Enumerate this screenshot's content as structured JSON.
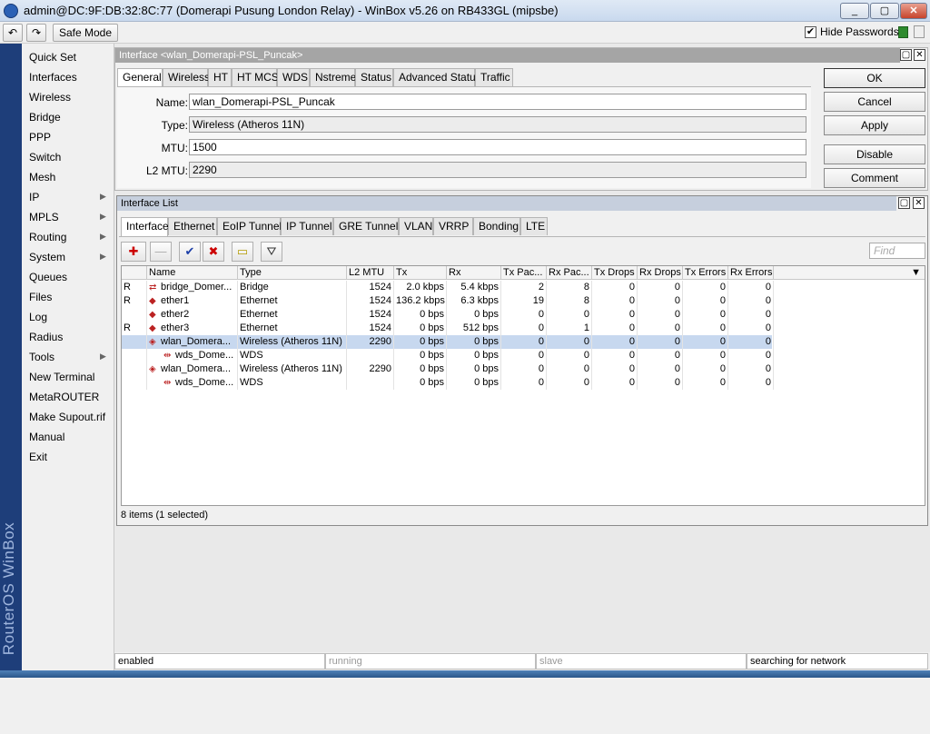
{
  "window": {
    "title": "admin@DC:9F:DB:32:8C:77 (Domerapi Pusung London Relay) - WinBox v5.26 on RB433GL (mipsbe)",
    "min_label": "_",
    "max_label": "▢",
    "close_label": "✕"
  },
  "toolbar": {
    "undo_icon": "↶",
    "redo_icon": "↷",
    "safe_mode_label": "Safe Mode",
    "hide_passwords_label": "Hide Passwords",
    "hide_passwords_checked": "✔"
  },
  "brand": {
    "text": "RouterOS WinBox"
  },
  "menu": {
    "items": [
      {
        "label": "Quick Set",
        "arrow": ""
      },
      {
        "label": "Interfaces",
        "arrow": ""
      },
      {
        "label": "Wireless",
        "arrow": ""
      },
      {
        "label": "Bridge",
        "arrow": ""
      },
      {
        "label": "PPP",
        "arrow": ""
      },
      {
        "label": "Switch",
        "arrow": ""
      },
      {
        "label": "Mesh",
        "arrow": ""
      },
      {
        "label": "IP",
        "arrow": "▶"
      },
      {
        "label": "MPLS",
        "arrow": "▶"
      },
      {
        "label": "Routing",
        "arrow": "▶"
      },
      {
        "label": "System",
        "arrow": "▶"
      },
      {
        "label": "Queues",
        "arrow": ""
      },
      {
        "label": "Files",
        "arrow": ""
      },
      {
        "label": "Log",
        "arrow": ""
      },
      {
        "label": "Radius",
        "arrow": ""
      },
      {
        "label": "Tools",
        "arrow": "▶"
      },
      {
        "label": "New Terminal",
        "arrow": ""
      },
      {
        "label": "MetaROUTER",
        "arrow": ""
      },
      {
        "label": "Make Supout.rif",
        "arrow": ""
      },
      {
        "label": "Manual",
        "arrow": ""
      },
      {
        "label": "Exit",
        "arrow": ""
      }
    ]
  },
  "iface_window": {
    "title": "Interface <wlan_Domerapi-PSL_Puncak>",
    "tabs": [
      "General",
      "Wireless",
      "HT",
      "HT MCS",
      "WDS",
      "Nstreme",
      "Status",
      "Advanced Status",
      "Traffic"
    ],
    "fields": {
      "name_label": "Name:",
      "name_value": "wlan_Domerapi-PSL_Puncak",
      "type_label": "Type:",
      "type_value": "Wireless (Atheros 11N)",
      "mtu_label": "MTU:",
      "mtu_value": "1500",
      "l2mtu_label": "L2 MTU:",
      "l2mtu_value": "2290"
    },
    "buttons": {
      "ok": "OK",
      "cancel": "Cancel",
      "apply": "Apply",
      "disable": "Disable",
      "comment": "Comment"
    }
  },
  "list_window": {
    "title": "Interface List",
    "tabs": [
      "Interface",
      "Ethernet",
      "EoIP Tunnel",
      "IP Tunnel",
      "GRE Tunnel",
      "VLAN",
      "VRRP",
      "Bonding",
      "LTE"
    ],
    "tool_icons": {
      "add": "✚",
      "remove": "—",
      "enable": "✔",
      "disable": "✖",
      "comment": "▭",
      "filter": "⛛"
    },
    "find_placeholder": "Find",
    "columns": [
      "",
      "Name",
      "Type",
      "L2 MTU",
      "Tx",
      "Rx",
      "Tx Pac...",
      "Rx Pac...",
      "Tx Drops",
      "Rx Drops",
      "Tx Errors",
      "Rx Errors"
    ],
    "dropdown_icon": "▼",
    "rows": [
      {
        "flag": "R",
        "icon": "⇄",
        "name": "bridge_Domer...",
        "type": "Bridge",
        "l2mtu": "1524",
        "tx": "2.0 kbps",
        "rx": "5.4 kbps",
        "txp": "2",
        "rxp": "8",
        "txd": "0",
        "rxd": "0",
        "txe": "0",
        "rxe": "0",
        "indent": false,
        "selected": false
      },
      {
        "flag": "R",
        "icon": "◆",
        "name": "ether1",
        "type": "Ethernet",
        "l2mtu": "1524",
        "tx": "136.2 kbps",
        "rx": "6.3 kbps",
        "txp": "19",
        "rxp": "8",
        "txd": "0",
        "rxd": "0",
        "txe": "0",
        "rxe": "0",
        "indent": false,
        "selected": false
      },
      {
        "flag": "",
        "icon": "◆",
        "name": "ether2",
        "type": "Ethernet",
        "l2mtu": "1524",
        "tx": "0 bps",
        "rx": "0 bps",
        "txp": "0",
        "rxp": "0",
        "txd": "0",
        "rxd": "0",
        "txe": "0",
        "rxe": "0",
        "indent": false,
        "selected": false
      },
      {
        "flag": "R",
        "icon": "◆",
        "name": "ether3",
        "type": "Ethernet",
        "l2mtu": "1524",
        "tx": "0 bps",
        "rx": "512 bps",
        "txp": "0",
        "rxp": "1",
        "txd": "0",
        "rxd": "0",
        "txe": "0",
        "rxe": "0",
        "indent": false,
        "selected": false
      },
      {
        "flag": "",
        "icon": "◈",
        "name": "wlan_Domera...",
        "type": "Wireless (Atheros 11N)",
        "l2mtu": "2290",
        "tx": "0 bps",
        "rx": "0 bps",
        "txp": "0",
        "rxp": "0",
        "txd": "0",
        "rxd": "0",
        "txe": "0",
        "rxe": "0",
        "indent": false,
        "selected": true
      },
      {
        "flag": "",
        "icon": "⇹",
        "name": "wds_Dome...",
        "type": "WDS",
        "l2mtu": "",
        "tx": "0 bps",
        "rx": "0 bps",
        "txp": "0",
        "rxp": "0",
        "txd": "0",
        "rxd": "0",
        "txe": "0",
        "rxe": "0",
        "indent": true,
        "selected": false
      },
      {
        "flag": "",
        "icon": "◈",
        "name": "wlan_Domera...",
        "type": "Wireless (Atheros 11N)",
        "l2mtu": "2290",
        "tx": "0 bps",
        "rx": "0 bps",
        "txp": "0",
        "rxp": "0",
        "txd": "0",
        "rxd": "0",
        "txe": "0",
        "rxe": "0",
        "indent": false,
        "selected": false
      },
      {
        "flag": "",
        "icon": "⇹",
        "name": "wds_Dome...",
        "type": "WDS",
        "l2mtu": "",
        "tx": "0 bps",
        "rx": "0 bps",
        "txp": "0",
        "rxp": "0",
        "txd": "0",
        "rxd": "0",
        "txe": "0",
        "rxe": "0",
        "indent": true,
        "selected": false
      }
    ],
    "status": "8 items (1 selected)"
  },
  "statusbar": {
    "s1": "enabled",
    "s2": "running",
    "s3": "slave",
    "s4": "searching for network"
  },
  "colors": {
    "accent": "#1e3e7a",
    "selection": "#c7d8ef",
    "title_gray": "#a5a5a5"
  }
}
